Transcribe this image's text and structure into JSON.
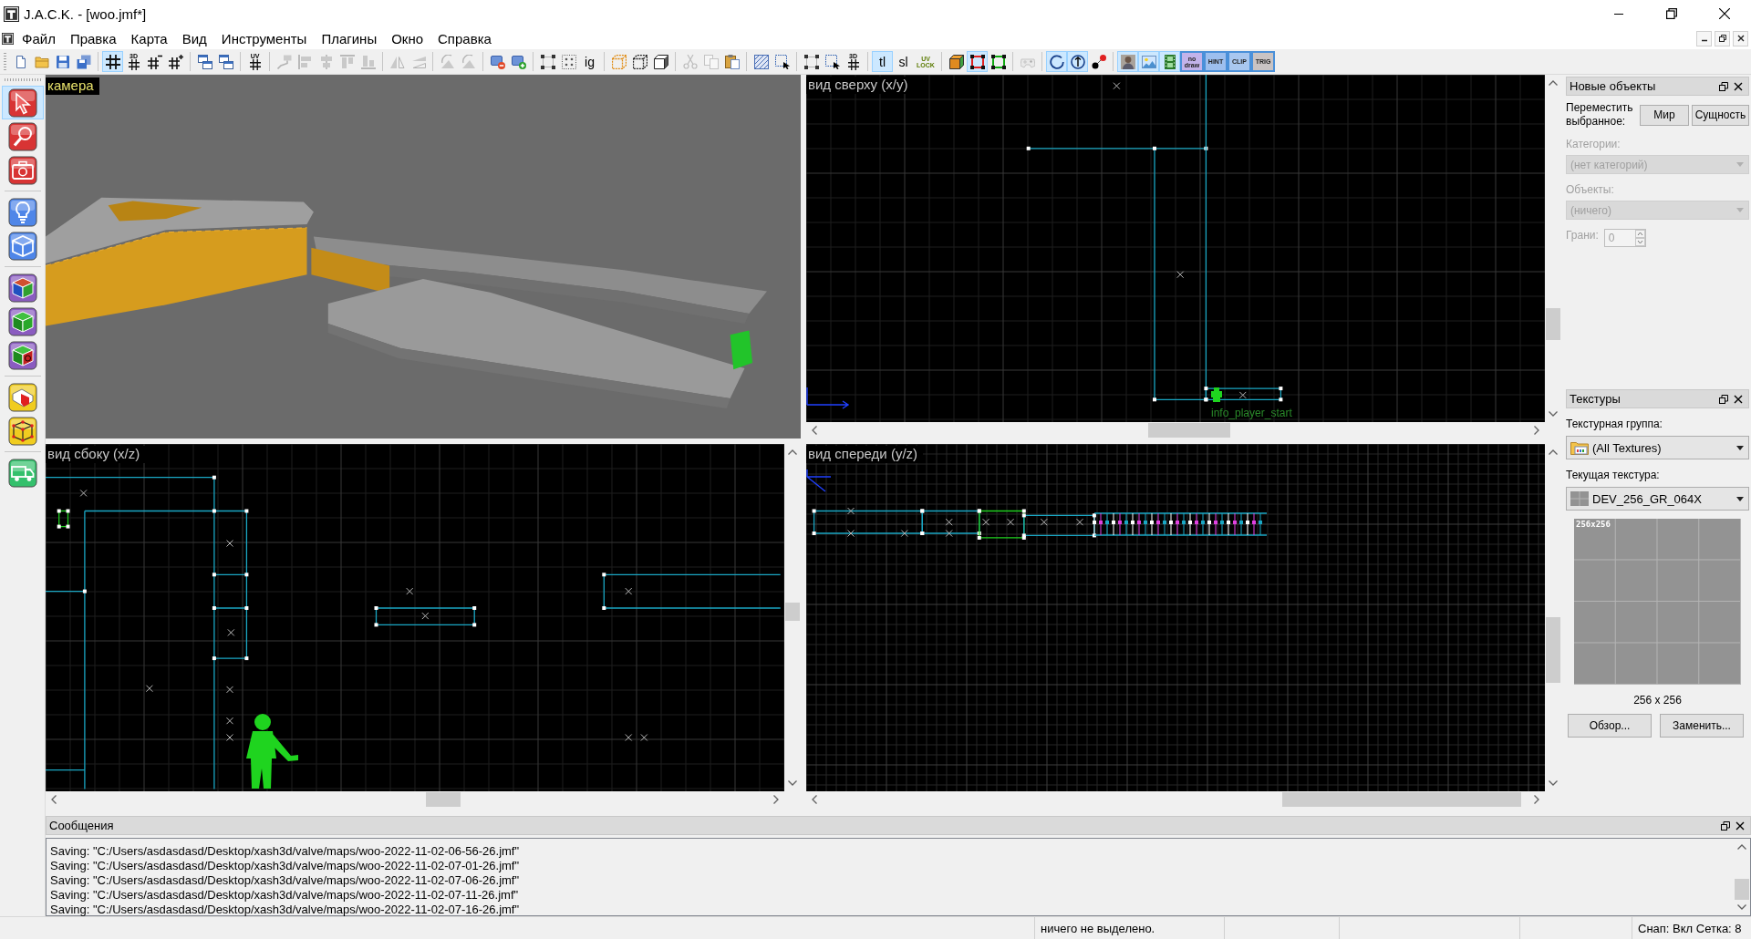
{
  "window": {
    "title": "J.A.C.K. - [woo.jmf*]"
  },
  "menu": [
    "Файл",
    "Правка",
    "Карта",
    "Вид",
    "Инструменты",
    "Плагины",
    "Окно",
    "Справка"
  ],
  "toolbar": [
    [
      {
        "kind": "page",
        "selected": false,
        "disabled": false
      },
      {
        "kind": "folder",
        "selected": false,
        "disabled": false
      },
      {
        "kind": "disk",
        "selected": false,
        "disabled": false
      },
      {
        "kind": "disks",
        "selected": false,
        "disabled": false
      }
    ],
    [
      {
        "kind": "grid",
        "selected": true,
        "disabled": false
      },
      {
        "kind": "grid",
        "label": "3D",
        "selected": false,
        "disabled": false
      },
      {
        "kind": "grid-minus",
        "selected": false,
        "disabled": false
      },
      {
        "kind": "grid-plus",
        "selected": false,
        "disabled": false
      }
    ],
    [
      {
        "kind": "windows",
        "selected": false,
        "disabled": false
      },
      {
        "kind": "windows",
        "selected": false,
        "disabled": false
      }
    ],
    [
      {
        "kind": "grid",
        "label": "UV",
        "selected": false,
        "disabled": false
      }
    ],
    [
      {
        "kind": "brush",
        "selected": false,
        "disabled": true
      },
      {
        "kind": "align-left",
        "selected": false,
        "disabled": true
      },
      {
        "kind": "align-center",
        "selected": false,
        "disabled": true
      },
      {
        "kind": "align-top",
        "selected": false,
        "disabled": true
      },
      {
        "kind": "align-bottom",
        "selected": false,
        "disabled": true
      }
    ],
    [
      {
        "kind": "flip-x",
        "selected": false,
        "disabled": true
      },
      {
        "kind": "flip-y",
        "selected": false,
        "disabled": true
      }
    ],
    [
      {
        "kind": "rotate",
        "selected": false,
        "disabled": true
      },
      {
        "kind": "rotate",
        "selected": false,
        "disabled": true
      }
    ],
    [
      {
        "kind": "box-minus",
        "selected": false,
        "disabled": false
      },
      {
        "kind": "box-plus",
        "selected": false,
        "disabled": false
      }
    ],
    [
      {
        "kind": "corners",
        "selected": false,
        "disabled": false
      },
      {
        "kind": "dots",
        "selected": false,
        "disabled": false
      },
      {
        "kind": "text",
        "label": "ig",
        "selected": false,
        "disabled": false
      }
    ],
    [
      {
        "kind": "cube-dashed",
        "selected": false,
        "disabled": false
      },
      {
        "kind": "cube-dotted",
        "selected": false,
        "disabled": false
      },
      {
        "kind": "cube",
        "selected": false,
        "disabled": false
      }
    ],
    [
      {
        "kind": "scissors",
        "selected": false,
        "disabled": true
      },
      {
        "kind": "copy",
        "selected": false,
        "disabled": true
      },
      {
        "kind": "paste",
        "selected": false,
        "disabled": false
      }
    ],
    [
      {
        "kind": "hatch",
        "selected": false,
        "disabled": false
      },
      {
        "kind": "marquee",
        "selected": false,
        "disabled": false
      }
    ],
    [
      {
        "kind": "corners",
        "selected": false,
        "disabled": false
      },
      {
        "kind": "marquee",
        "selected": false,
        "disabled": false
      },
      {
        "kind": "grid",
        "label": "3D",
        "selected": false,
        "disabled": false
      }
    ],
    [
      {
        "kind": "text",
        "label": "tl",
        "selected": true,
        "disabled": false
      },
      {
        "kind": "text",
        "label": "sl",
        "selected": false,
        "disabled": false
      },
      {
        "kind": "caption",
        "label": "UV LOCK",
        "selected": false,
        "disabled": false
      }
    ],
    [
      {
        "kind": "cube-face",
        "selected": false,
        "disabled": false
      },
      {
        "kind": "frame",
        "color": "#e02020",
        "selected": true,
        "disabled": false
      },
      {
        "kind": "frame",
        "color": "#10a810",
        "selected": false,
        "disabled": false
      }
    ],
    [
      {
        "kind": "gamepad",
        "selected": false,
        "disabled": true
      }
    ],
    [
      {
        "kind": "circle",
        "selected": true,
        "disabled": false
      },
      {
        "kind": "circle-arrow",
        "selected": true,
        "disabled": false
      },
      {
        "kind": "dot-pair",
        "selected": false,
        "disabled": false
      }
    ],
    [
      {
        "kind": "person",
        "selected": true,
        "disabled": false
      },
      {
        "kind": "picture",
        "selected": true,
        "disabled": false
      },
      {
        "kind": "film",
        "selected": true,
        "disabled": false
      },
      {
        "kind": "tile",
        "label": "no draw",
        "color": "#c3b3ea",
        "selected": true,
        "disabled": false
      },
      {
        "kind": "tile",
        "label": "HINT",
        "color": "#9dbfee",
        "selected": true,
        "disabled": false
      },
      {
        "kind": "tile",
        "label": "CLIP",
        "color": "#a9c7ef",
        "selected": true,
        "disabled": false
      },
      {
        "kind": "tile",
        "label": "TRIG",
        "color": "#c9c3c3",
        "selected": true,
        "disabled": false
      }
    ]
  ],
  "tools": [
    [
      {
        "kind": "pointer",
        "selected": true
      },
      {
        "kind": "magnifier",
        "selected": false
      },
      {
        "kind": "camera",
        "selected": false
      }
    ],
    [
      {
        "kind": "bulb",
        "selected": false
      },
      {
        "kind": "cube-outline",
        "selected": false
      }
    ],
    [
      {
        "kind": "cube-faces",
        "selected": false
      },
      {
        "kind": "cube-green",
        "selected": false
      },
      {
        "kind": "cube-target",
        "selected": false
      }
    ],
    [
      {
        "kind": "block",
        "selected": false
      },
      {
        "kind": "vertices",
        "selected": false
      }
    ],
    [
      {
        "kind": "truck",
        "selected": false
      }
    ]
  ],
  "viewports": [
    {
      "kind": "camera",
      "title": "камера"
    },
    {
      "kind": "top",
      "title": "вид сверху (x/y)",
      "entity_label": "info_player_start"
    },
    {
      "kind": "side",
      "title": "вид сбоку (x/z)"
    },
    {
      "kind": "front",
      "title": "вид спереди (y/z)"
    }
  ],
  "new_objects": {
    "title": "Новые объекты",
    "move_label": "Переместить выбранное:",
    "move_buttons": [
      "Мир",
      "Сущность"
    ],
    "fields": [
      {
        "kind": "combo",
        "label": "Категории:",
        "value": "(нет категорий)",
        "disabled": true
      },
      {
        "kind": "combo",
        "label": "Объекты:",
        "value": "(ничего)",
        "disabled": true
      },
      {
        "kind": "spin",
        "label": "Грани:",
        "value": "0",
        "disabled": true
      }
    ]
  },
  "textures": {
    "title": "Текстуры",
    "group_label": "Текстурная группа:",
    "group_value": "(All Textures)",
    "current_label": "Текущая текстура:",
    "current_value": "DEV_256_GR_064X",
    "preview_label": "256x256",
    "size": "256 x 256",
    "buttons": [
      "Обзор...",
      "Заменить..."
    ]
  },
  "messages": {
    "title": "Сообщения",
    "lines": [
      "Saving: \"C:/Users/asdasdasd/Desktop/xash3d/valve/maps/woo-2022-11-02-06-56-26.jmf\"",
      "Saving: \"C:/Users/asdasdasd/Desktop/xash3d/valve/maps/woo-2022-11-02-07-01-26.jmf\"",
      "Saving: \"C:/Users/asdasdasd/Desktop/xash3d/valve/maps/woo-2022-11-02-07-06-26.jmf\"",
      "Saving: \"C:/Users/asdasdasd/Desktop/xash3d/valve/maps/woo-2022-11-02-07-11-26.jmf\"",
      "Saving: \"C:/Users/asdasdasd/Desktop/xash3d/valve/maps/woo-2022-11-02-07-16-26.jmf\""
    ]
  },
  "status_bar": {
    "selection": "ничего не выделено.",
    "snap": "Снап: Вкл Сетка: 8"
  }
}
